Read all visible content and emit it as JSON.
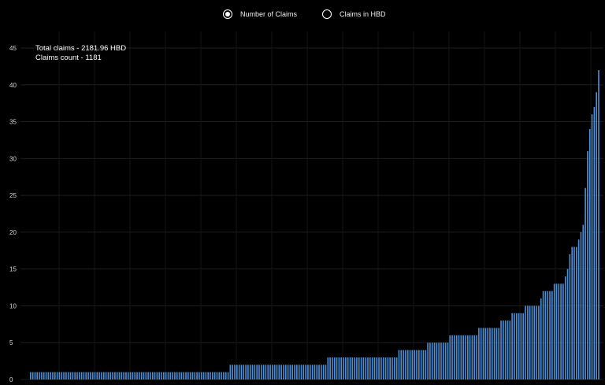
{
  "toggle": {
    "options": [
      {
        "label": "Number of Claims",
        "selected": true
      },
      {
        "label": "Claims in HBD",
        "selected": false
      }
    ]
  },
  "summary": {
    "total_claims": "Total claims - 2181.96 HBD",
    "claims_count": "Claims count - 1181"
  },
  "colors": {
    "background": "#000000",
    "bar": "#4a90d9",
    "gridline": "#1e1e1e",
    "text": "#d8d8d8"
  },
  "chart_data": {
    "type": "bar",
    "ylim": [
      0,
      45
    ],
    "yticks": [
      0,
      5,
      10,
      15,
      20,
      25,
      30,
      35,
      40,
      45
    ],
    "grid": true,
    "legend": "none",
    "values": [
      1,
      1,
      1,
      1,
      1,
      1,
      1,
      1,
      1,
      1,
      1,
      1,
      1,
      1,
      1,
      1,
      1,
      1,
      1,
      1,
      1,
      1,
      1,
      1,
      1,
      1,
      1,
      1,
      1,
      1,
      1,
      1,
      1,
      1,
      1,
      1,
      1,
      1,
      1,
      1,
      1,
      1,
      1,
      1,
      1,
      1,
      1,
      1,
      1,
      1,
      1,
      1,
      1,
      1,
      1,
      1,
      1,
      1,
      1,
      1,
      1,
      1,
      1,
      1,
      1,
      1,
      1,
      1,
      1,
      1,
      1,
      1,
      1,
      1,
      1,
      1,
      1,
      1,
      1,
      1,
      1,
      1,
      1,
      1,
      1,
      1,
      1,
      1,
      1,
      1,
      2,
      2,
      2,
      2,
      2,
      2,
      2,
      2,
      2,
      2,
      2,
      2,
      2,
      2,
      2,
      2,
      2,
      2,
      2,
      2,
      2,
      2,
      2,
      2,
      2,
      2,
      2,
      2,
      2,
      2,
      2,
      2,
      2,
      2,
      2,
      2,
      2,
      2,
      2,
      2,
      2,
      2,
      2,
      2,
      3,
      3,
      3,
      3,
      3,
      3,
      3,
      3,
      3,
      3,
      3,
      3,
      3,
      3,
      3,
      3,
      3,
      3,
      3,
      3,
      3,
      3,
      3,
      3,
      3,
      3,
      3,
      3,
      3,
      3,
      3,
      3,
      4,
      4,
      4,
      4,
      4,
      4,
      4,
      4,
      4,
      4,
      4,
      4,
      4,
      5,
      5,
      5,
      5,
      5,
      5,
      5,
      5,
      5,
      5,
      6,
      6,
      6,
      6,
      6,
      6,
      6,
      6,
      6,
      6,
      6,
      6,
      6,
      7,
      7,
      7,
      7,
      7,
      7,
      7,
      7,
      7,
      7,
      8,
      8,
      8,
      8,
      8,
      9,
      9,
      9,
      9,
      9,
      9,
      10,
      10,
      10,
      10,
      10,
      10,
      10,
      11,
      12,
      12,
      12,
      12,
      12,
      13,
      13,
      13,
      13,
      13,
      14,
      15,
      17,
      18,
      18,
      18,
      19,
      20,
      21,
      26,
      31,
      34,
      36,
      37,
      39,
      42
    ]
  }
}
